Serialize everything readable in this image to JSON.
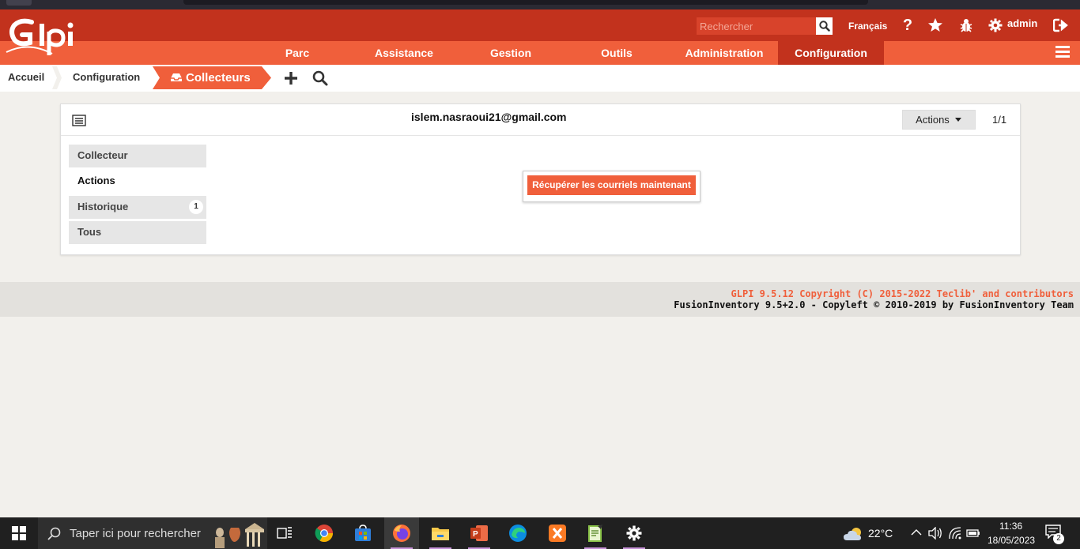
{
  "header": {
    "search_placeholder": "Rechercher",
    "language": "Français",
    "user": "admin"
  },
  "nav": {
    "items": [
      "Parc",
      "Assistance",
      "Gestion",
      "Outils",
      "Administration",
      "Configuration"
    ],
    "active": "Configuration"
  },
  "breadcrumb": {
    "home": "Accueil",
    "section": "Configuration",
    "current": "Collecteurs"
  },
  "panel": {
    "title": "islem.nasraoui21@gmail.com",
    "actions_label": "Actions",
    "pager": "1/1",
    "tabs": [
      {
        "label": "Collecteur"
      },
      {
        "label": "Actions"
      },
      {
        "label": "Historique",
        "count": "1"
      },
      {
        "label": "Tous"
      }
    ],
    "fetch_button": "Récupérer les courriels maintenant"
  },
  "footer": {
    "line1": "GLPI 9.5.12 Copyright (C) 2015-2022 Teclib' and contributors",
    "line2": "FusionInventory 9.5+2.0 - Copyleft © 2010-2019 by FusionInventory Team"
  },
  "taskbar": {
    "search_placeholder": "Taper ici pour rechercher",
    "temperature": "22°C",
    "time": "11:36",
    "date": "18/05/2023",
    "notifications": "2"
  },
  "colors": {
    "header_dark": "#c2321d",
    "header_accent": "#f05f3b"
  }
}
